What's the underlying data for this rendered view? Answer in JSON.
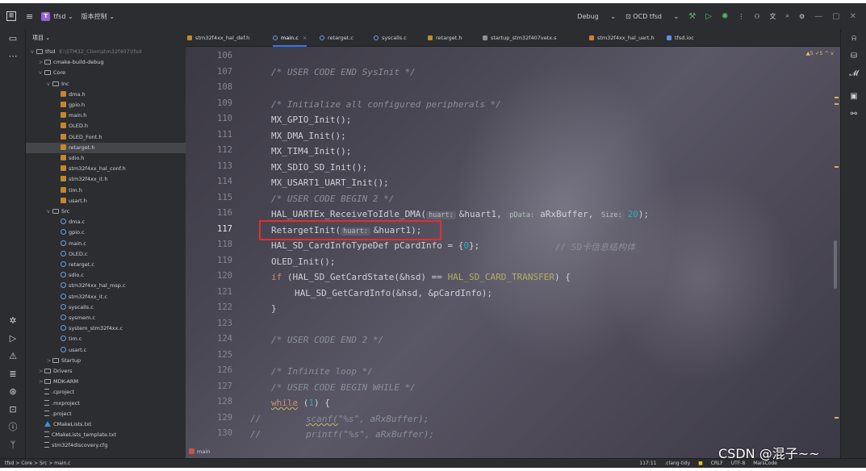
{
  "titlebar": {
    "menu_icon": "hamburger-icon",
    "project_badge": "T",
    "project_name": "tfsd",
    "vcs_label": "版本控制",
    "run_config": "Debug",
    "ocd_config": "OCD tfsd",
    "window_controls": [
      "—",
      "▢",
      "✕"
    ]
  },
  "project": {
    "header": "项目",
    "tree": [
      {
        "label": "tfsd",
        "muted": "E:\\STM32_Clion\\stm32f407\\tfsd",
        "indent": 0,
        "icon": "folder",
        "chev": "v"
      },
      {
        "label": "cmake-build-debug",
        "indent": 1,
        "icon": "folder",
        "chev": ">"
      },
      {
        "label": "Core",
        "indent": 1,
        "icon": "folder",
        "chev": "v"
      },
      {
        "label": "Inc",
        "indent": 2,
        "icon": "folder",
        "chev": "v"
      },
      {
        "label": "dma.h",
        "indent": 3,
        "icon": "h"
      },
      {
        "label": "gpio.h",
        "indent": 3,
        "icon": "h"
      },
      {
        "label": "main.h",
        "indent": 3,
        "icon": "h"
      },
      {
        "label": "OLED.h",
        "indent": 3,
        "icon": "h"
      },
      {
        "label": "OLED_Font.h",
        "indent": 3,
        "icon": "h"
      },
      {
        "label": "retarget.h",
        "indent": 3,
        "icon": "h",
        "selected": true
      },
      {
        "label": "sdio.h",
        "indent": 3,
        "icon": "h"
      },
      {
        "label": "stm32f4xx_hal_conf.h",
        "indent": 3,
        "icon": "h"
      },
      {
        "label": "stm32f4xx_it.h",
        "indent": 3,
        "icon": "h"
      },
      {
        "label": "tim.h",
        "indent": 3,
        "icon": "h"
      },
      {
        "label": "usart.h",
        "indent": 3,
        "icon": "h"
      },
      {
        "label": "Src",
        "indent": 2,
        "icon": "folder",
        "chev": "v"
      },
      {
        "label": "dma.c",
        "indent": 3,
        "icon": "c"
      },
      {
        "label": "gpio.c",
        "indent": 3,
        "icon": "c"
      },
      {
        "label": "main.c",
        "indent": 3,
        "icon": "c"
      },
      {
        "label": "OLED.c",
        "indent": 3,
        "icon": "c"
      },
      {
        "label": "retarget.c",
        "indent": 3,
        "icon": "c"
      },
      {
        "label": "sdio.c",
        "indent": 3,
        "icon": "c"
      },
      {
        "label": "stm32f4xx_hal_msp.c",
        "indent": 3,
        "icon": "c"
      },
      {
        "label": "stm32f4xx_it.c",
        "indent": 3,
        "icon": "c"
      },
      {
        "label": "syscalls.c",
        "indent": 3,
        "icon": "c"
      },
      {
        "label": "sysmem.c",
        "indent": 3,
        "icon": "c"
      },
      {
        "label": "system_stm32f4xx.c",
        "indent": 3,
        "icon": "c"
      },
      {
        "label": "tim.c",
        "indent": 3,
        "icon": "c"
      },
      {
        "label": "usart.c",
        "indent": 3,
        "icon": "c"
      },
      {
        "label": "Startup",
        "indent": 2,
        "icon": "folder",
        "chev": ">"
      },
      {
        "label": "Drivers",
        "indent": 1,
        "icon": "folder",
        "chev": ">"
      },
      {
        "label": "MDK-ARM",
        "indent": 1,
        "icon": "folder",
        "chev": ">"
      },
      {
        "label": ".cproject",
        "indent": 1,
        "icon": "txt"
      },
      {
        "label": ".mxproject",
        "indent": 1,
        "icon": "txt"
      },
      {
        "label": ".project",
        "indent": 1,
        "icon": "txt"
      },
      {
        "label": "CMakeLists.txt",
        "indent": 1,
        "icon": "cmake"
      },
      {
        "label": "CMakeLists_template.txt",
        "indent": 1,
        "icon": "txt"
      },
      {
        "label": "stm32f4discovery.cfg",
        "indent": 1,
        "icon": "txt"
      }
    ]
  },
  "tabs": [
    {
      "label": "stm32f4xx_hal_def.h",
      "icon": "h"
    },
    {
      "label": "main.c",
      "icon": "c",
      "active": true,
      "close": "×"
    },
    {
      "label": "retarget.c",
      "icon": "c"
    },
    {
      "label": "syscalls.c",
      "icon": "c"
    },
    {
      "label": "retarget.h",
      "icon": "h"
    },
    {
      "label": "startup_stm32f407vetx.s",
      "icon": "s"
    },
    {
      "label": "stm32f4xx_hal_uart.h",
      "icon": "h"
    },
    {
      "label": "tfsd.ioc",
      "icon": "ioc"
    }
  ],
  "inspection": "▲5  ✓5  ^  v",
  "editor": {
    "current_line": "117",
    "line_numbers": [
      "106",
      "107",
      "108",
      "109",
      "110",
      "111",
      "112",
      "113",
      "114",
      "115",
      "116",
      "117",
      "118",
      "119",
      "120",
      "121",
      "122",
      "123",
      "124",
      "125",
      "126",
      "127",
      "128",
      "129",
      "130"
    ],
    "lines": {
      "l107": "/* USER CODE END SysInit */",
      "l109": "/* Initialize all configured peripherals */",
      "l110": "MX_GPIO_Init();",
      "l111": "MX_DMA_Init();",
      "l112": "MX_TIM4_Init();",
      "l113": "MX_SDIO_SD_Init();",
      "l114": "MX_USART1_UART_Init();",
      "l115": "/* USER CODE BEGIN 2 */",
      "l116_a": "HAL_UARTEx_ReceiveToIdle_DMA(",
      "l116_h1": "huart:",
      "l116_b": "&huart1,",
      "l116_h2": "pData:",
      "l116_c": "aRxBuffer,",
      "l116_h3": "Size:",
      "l116_d": "20",
      "l116_e": ");",
      "l117_a": "RetargetInit(",
      "l117_h": "huart:",
      "l117_b": "&huart1);",
      "l118_a": "HAL_SD_CardInfoTypeDef pCardInfo = {",
      "l118_n": "0",
      "l118_b": "};",
      "l118_c": "// SD卡信息结构体",
      "l119": "OLED_Init();",
      "l120_kw": "if",
      "l120_a": " (HAL_SD_GetCardState(&hsd) == ",
      "l120_m": "HAL_SD_CARD_TRANSFER",
      "l120_b": ") {",
      "l121": "HAL_SD_GetCardInfo(&hsd, &pCardInfo);",
      "l122": "}",
      "l124": "/* USER CODE END 2 */",
      "l126": "/* Infinite loop */",
      "l127": "/* USER CODE BEGIN WHILE */",
      "l128_kw": "while",
      "l128_a": " (",
      "l128_n": "1",
      "l128_b": ") {",
      "l129_slash": "//",
      "l129_a": "scanf(",
      "l129_s": "\"%s\"",
      "l129_b": ", aRxBuffer);",
      "l130_slash": "//",
      "l130_a": "printf(",
      "l130_s": "\"%s\"",
      "l130_b": ", aRxBuffer);"
    },
    "footer": "main"
  },
  "statusbar": {
    "breadcrumbs": "tfsd  >  Core  >  Src  >  main.c",
    "position": "117:11",
    "linter": ".clang-tidy",
    "line_sep": "CRLF",
    "encoding": "UTF-8",
    "plugin": "MarsCode"
  },
  "watermark": "CSDN @混子~~",
  "colors": {
    "accent": "#3574f0",
    "highlight_box": "#e0302e",
    "keyword": "#cf8e6d"
  }
}
